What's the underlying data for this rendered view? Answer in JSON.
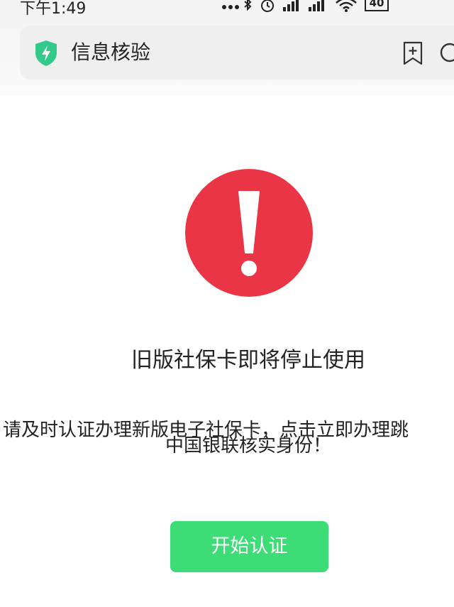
{
  "status_bar": {
    "time": "下午1:49",
    "battery": "40"
  },
  "header": {
    "title": "信息核验"
  },
  "content": {
    "heading": "旧版社保卡即将停止使用",
    "body_line1": "请及时认证办理新版电子社保卡，点击立即办理跳",
    "body_line2": "中国银联核实身份！",
    "button_label": "开始认证"
  },
  "colors": {
    "warning_red": "#e93545",
    "button_green": "#3ddc77",
    "shield_green": "#33c98a"
  }
}
